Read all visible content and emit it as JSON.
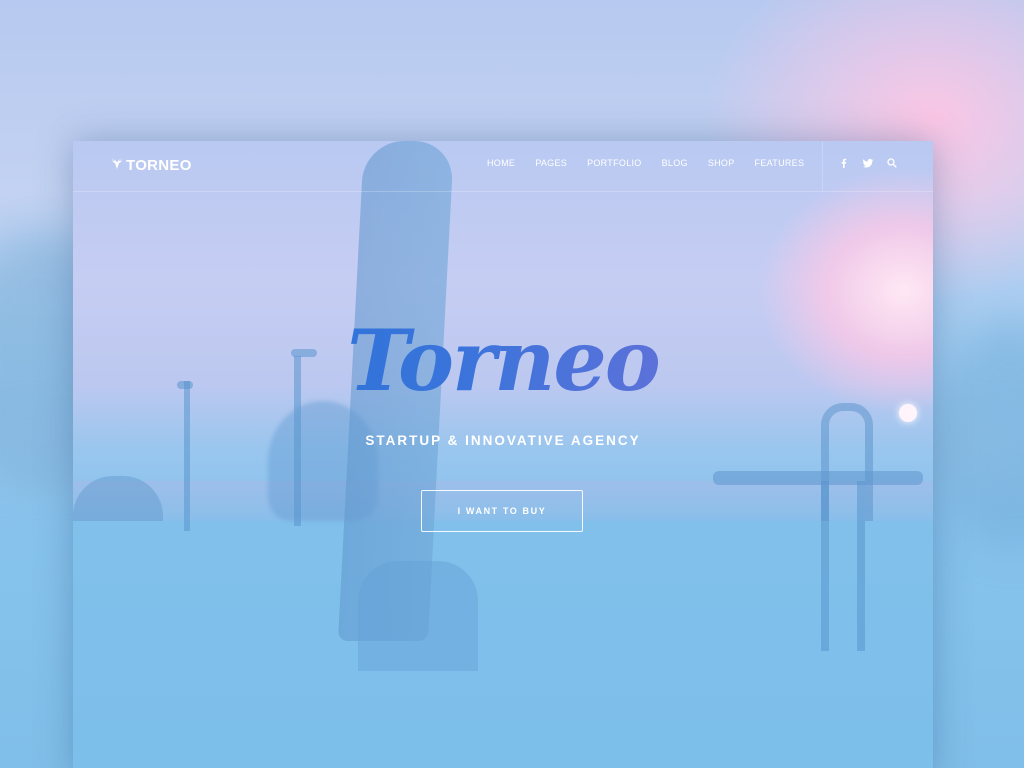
{
  "brand": {
    "logo_text": "TORNEO",
    "logo_icon": "deer-antlers-icon"
  },
  "nav": {
    "items": [
      {
        "label": "HOME"
      },
      {
        "label": "PAGES"
      },
      {
        "label": "PORTFOLIO"
      },
      {
        "label": "BLOG"
      },
      {
        "label": "SHOP"
      },
      {
        "label": "FEATURES"
      }
    ]
  },
  "social": {
    "icons": [
      "facebook-icon",
      "twitter-icon",
      "search-icon"
    ]
  },
  "hero": {
    "title": "Torneo",
    "subtitle": "STARTUP & INNOVATIVE AGENCY",
    "cta_label": "I WANT TO BUY"
  },
  "colors": {
    "title_gradient_start": "#1e73d6",
    "title_gradient_end": "#8a6fd6",
    "text": "#ffffff",
    "background_top": "#b9c9f2",
    "background_bottom": "#7ec1ea",
    "sun_glow": "#ffc8e6"
  }
}
